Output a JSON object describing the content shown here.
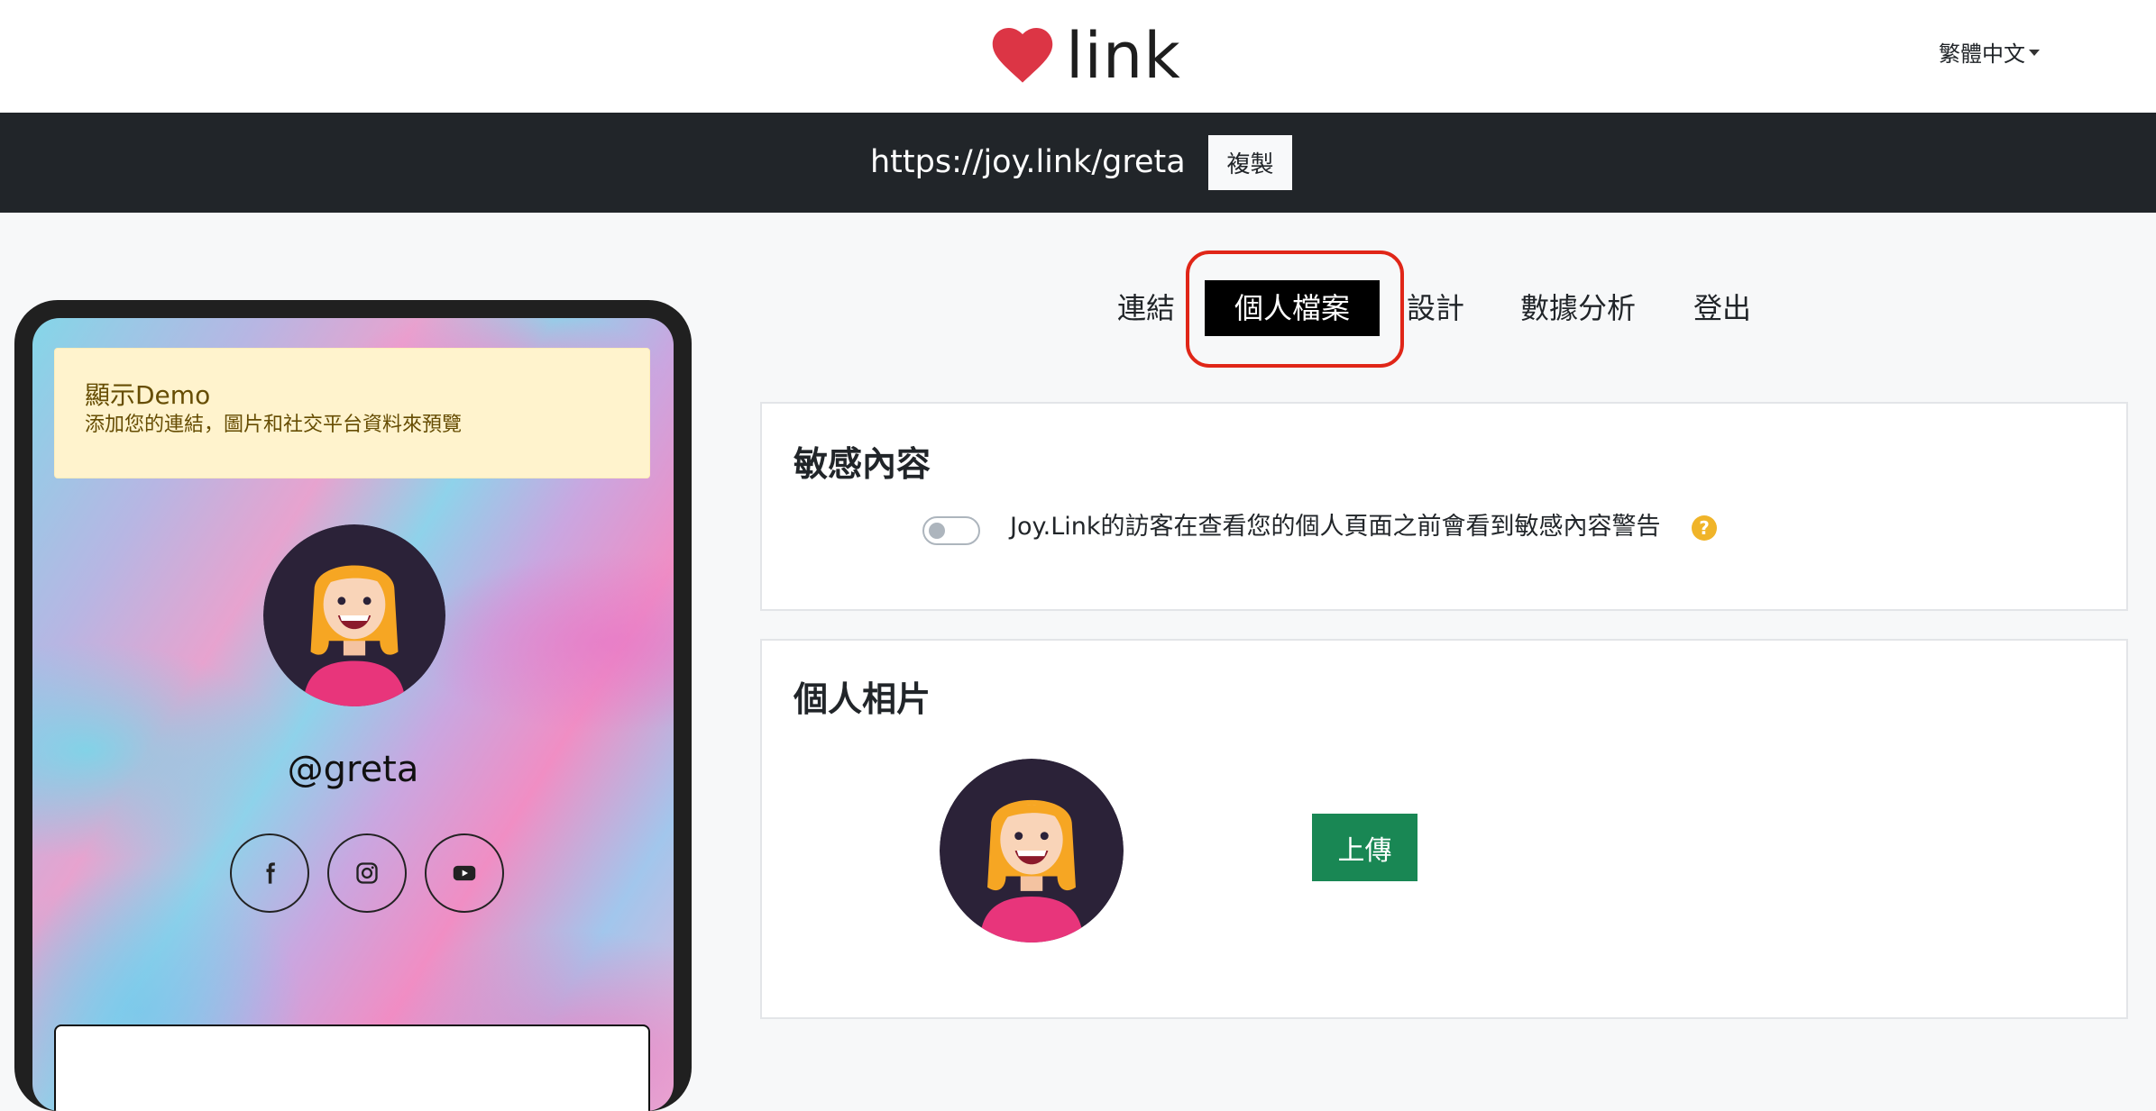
{
  "header": {
    "logo_text": "link",
    "language_selector": "繁體中文"
  },
  "url_bar": {
    "url": "https://joy.link/greta",
    "copy_label": "複製"
  },
  "tabs": [
    {
      "label": "連結",
      "active": false
    },
    {
      "label": "個人檔案",
      "active": true
    },
    {
      "label": "設計",
      "active": false
    },
    {
      "label": "數據分析",
      "active": false
    },
    {
      "label": "登出",
      "active": false
    }
  ],
  "preview": {
    "demo_title": "顯示Demo",
    "demo_subtitle": "添加您的連結，圖片和社交平台資料來預覽",
    "username": "@greta",
    "social_icons": [
      "facebook-icon",
      "instagram-icon",
      "youtube-icon"
    ]
  },
  "sensitive_card": {
    "title": "敏感內容",
    "toggle_label": "Joy.Link的訪客在查看您的個人頁面之前會看到敏感內容警告",
    "toggle_on": false,
    "help_glyph": "?"
  },
  "photo_card": {
    "title": "個人相片",
    "upload_label": "上傳"
  },
  "colors": {
    "heart": "#dc3545",
    "url_bar_bg": "#212529",
    "active_tab_bg": "#000000",
    "highlight_annotation": "#e02618",
    "upload_button": "#198754",
    "demo_note_bg": "#fff3cd",
    "help_icon": "#f0b429"
  }
}
